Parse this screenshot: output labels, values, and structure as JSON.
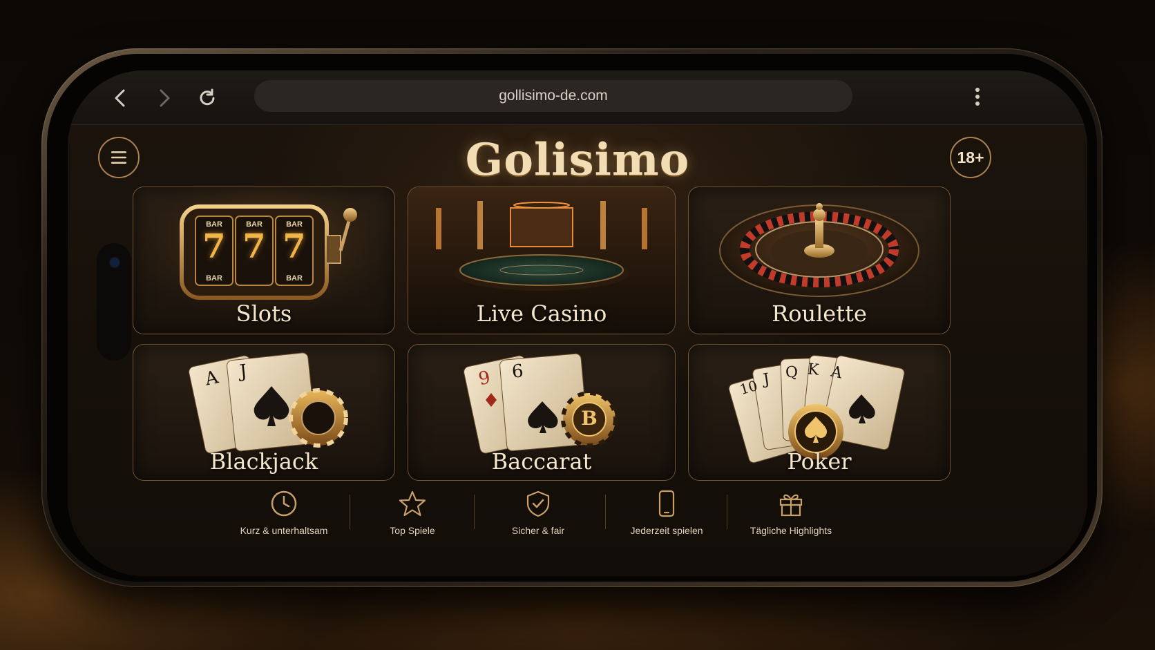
{
  "browser": {
    "url": "gollisimo-de.com"
  },
  "header": {
    "brand": "Golisimo",
    "age_badge": "18+"
  },
  "games": [
    {
      "label": "Slots",
      "icon": "slot-machine-icon"
    },
    {
      "label": "Live Casino",
      "icon": "casino-table-icon"
    },
    {
      "label": "Roulette",
      "icon": "roulette-wheel-icon"
    },
    {
      "label": "Blackjack",
      "icon": "blackjack-cards-icon"
    },
    {
      "label": "Baccarat",
      "icon": "baccarat-cards-icon"
    },
    {
      "label": "Poker",
      "icon": "poker-cards-icon"
    }
  ],
  "slot_reels": {
    "top": "BAR",
    "symbol": "7",
    "bottom": "BAR"
  },
  "cards": {
    "blackjack": [
      "A",
      "J"
    ],
    "baccarat": [
      "9",
      "6"
    ],
    "baccarat_chip": "B",
    "poker": [
      "10",
      "J",
      "Q",
      "K",
      "A"
    ]
  },
  "features": [
    {
      "label": "Kurz & unterhaltsam",
      "icon": "clock-icon"
    },
    {
      "label": "Top Spiele",
      "icon": "star-icon"
    },
    {
      "label": "Sicher & fair",
      "icon": "shield-check-icon"
    },
    {
      "label": "Jederzeit spielen",
      "icon": "smartphone-icon"
    },
    {
      "label": "Tägliche Highlights",
      "icon": "gift-icon"
    }
  ],
  "colors": {
    "gold": "#c9a06a",
    "label": "#f5e6cc",
    "background": "#120d08"
  }
}
